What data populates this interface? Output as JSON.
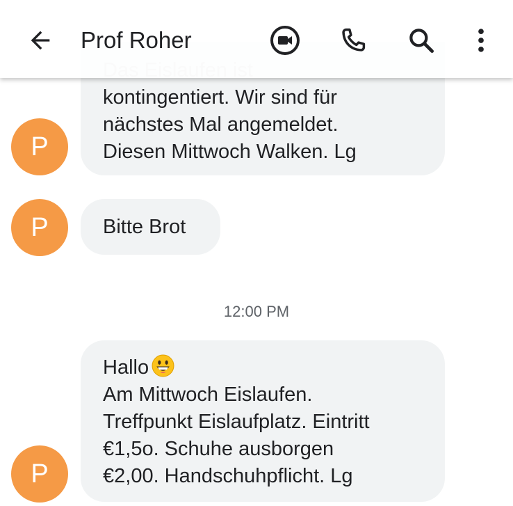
{
  "header": {
    "title": "Prof Roher",
    "back_icon": "arrow-back-icon",
    "actions": [
      {
        "name": "video-call",
        "icon": "video-call-icon"
      },
      {
        "name": "phone-call",
        "icon": "phone-icon"
      },
      {
        "name": "search",
        "icon": "search-icon"
      },
      {
        "name": "more-options",
        "icon": "more-vert-icon"
      }
    ]
  },
  "contact": {
    "avatar_letter": "P",
    "avatar_color": "#f59a46"
  },
  "messages": [
    {
      "lines": [
        "Das Eislaufen ist",
        "kontingentiert. Wir sind für",
        "nächstes Mal angemeldet.",
        "Diesen Mittwoch Walken. Lg"
      ]
    },
    {
      "lines": [
        "Bitte Brot"
      ]
    },
    {
      "lines": [
        "Hallo",
        "Am Mittwoch Eislaufen.",
        "Treffpunkt Eislaufplatz. Eintritt",
        "€1,5o. Schuhe ausborgen",
        "€2,00. Handschuhpflicht. Lg"
      ],
      "emoji": "grinning-face-emoji"
    }
  ],
  "timestamp": "12:00 PM",
  "colors": {
    "bubble": "#f1f3f4",
    "text": "#202124",
    "secondary_text": "#5f6368"
  }
}
